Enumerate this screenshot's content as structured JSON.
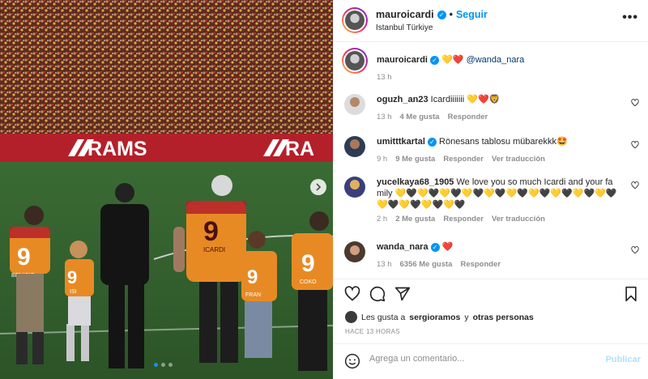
{
  "post": {
    "author": "mauroicardi",
    "follow_label": "Seguir",
    "location": "Istanbul Türkiye",
    "more_label": "•••",
    "verified_mark": "✓"
  },
  "photo": {
    "banner_text_1": "RAMS",
    "banner_text_2": "RA",
    "shirt_number": "9",
    "names": [
      "BENICIO",
      "ISI",
      "ICARDI",
      "FRAN",
      "COKO"
    ],
    "carousel_dots": 3,
    "active_dot": 0
  },
  "caption": {
    "user": "mauroicardi",
    "text_emojis": "💛❤️",
    "mention": "@wanda_nara",
    "time": "13 h"
  },
  "comments": [
    {
      "user": "oguzh_an23",
      "verified": false,
      "text": "Icardiiiiiii 💛❤️🦁",
      "time": "13 h",
      "likes": "4 Me gusta",
      "reply": "Responder",
      "translation": ""
    },
    {
      "user": "umitttkartal",
      "verified": true,
      "text": "Rönesans tablosu mübarekkk🤩",
      "time": "9 h",
      "likes": "9 Me gusta",
      "reply": "Responder",
      "translation": "Ver traducción"
    },
    {
      "user": "yucelkaya68_1905",
      "verified": false,
      "text": "We love you so much Icardi and your family 💛🖤💛🖤💛🖤💛🖤💛🖤💛🖤💛🖤💛🖤💛🖤💛🖤💛🖤💛🖤💛🖤💛🖤",
      "time": "2 h",
      "likes": "2 Me gusta",
      "reply": "Responder",
      "translation": "Ver traducción"
    },
    {
      "user": "wanda_nara",
      "verified": true,
      "text": "❤️",
      "time": "13 h",
      "likes": "6356 Me gusta",
      "reply": "Responder",
      "translation": ""
    }
  ],
  "likes_line": {
    "prefix": "Les gusta a",
    "user": "sergioramos",
    "middle": "y",
    "others": "otras personas"
  },
  "date_label": "HACE 13 HORAS",
  "composer": {
    "emoji_icon": "smiley-icon",
    "placeholder": "Agrega un comentario...",
    "publish_label": "Publicar"
  },
  "colors": {
    "accent_blue": "#0095f6",
    "galatasaray_red": "#b4202a",
    "galatasaray_yellow": "#f2a81d",
    "divider": "#efefef",
    "muted": "#8e8e8e"
  }
}
